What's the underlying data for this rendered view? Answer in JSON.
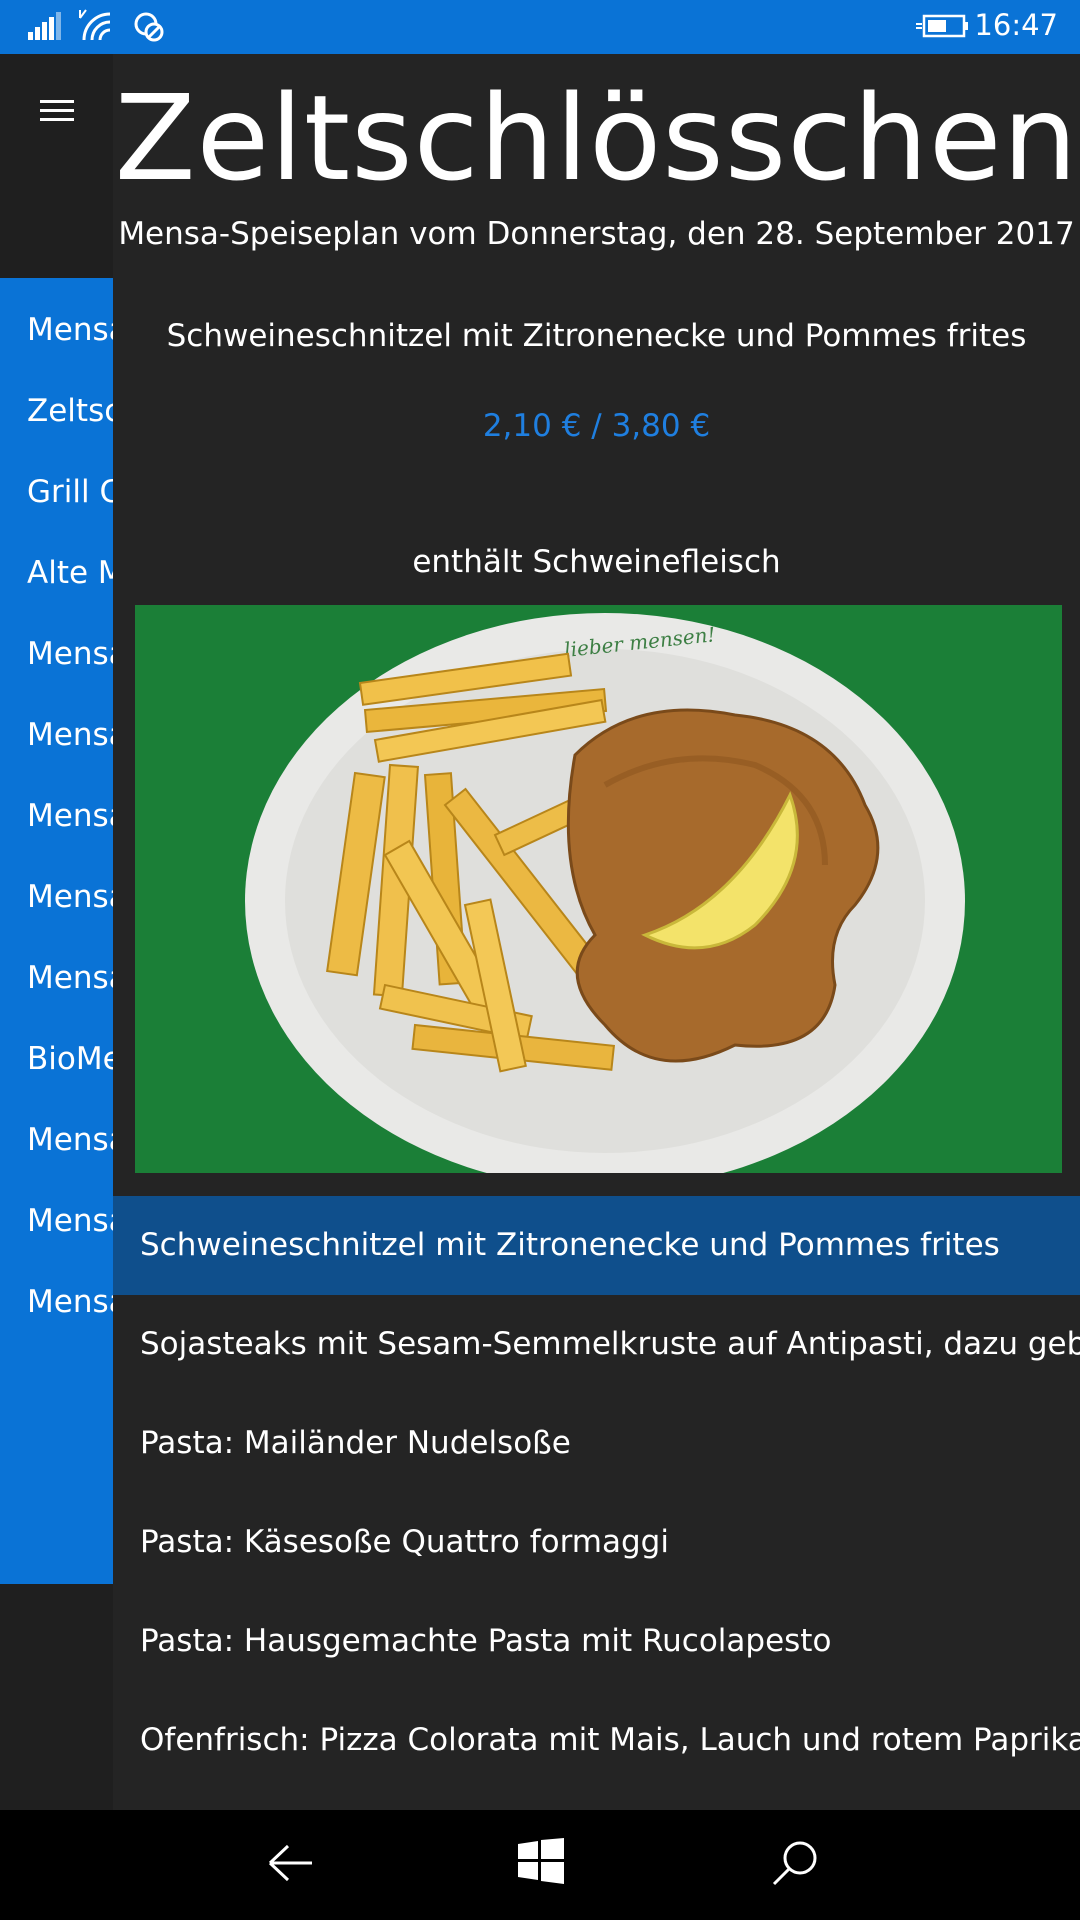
{
  "status_bar": {
    "time": "16:47",
    "icons": [
      "signal-icon",
      "wifi-icon",
      "location-off-icon",
      "battery-charging-icon"
    ],
    "bg_color": "#0a73d6"
  },
  "sidebar": {
    "menu_icon": "hamburger-icon",
    "items": [
      {
        "label": "Mensa"
      },
      {
        "label": "Zeltschlösschen"
      },
      {
        "label": "Grill Cube"
      },
      {
        "label": "Alte Mensa"
      },
      {
        "label": "Mensa"
      },
      {
        "label": "Mensa"
      },
      {
        "label": "Mensa"
      },
      {
        "label": "Mensa"
      },
      {
        "label": "Mensa"
      },
      {
        "label": "BioMensa"
      },
      {
        "label": "Mensa"
      },
      {
        "label": "Mensa"
      },
      {
        "label": "Mensa"
      }
    ]
  },
  "header": {
    "title": "Zeltschlösschen",
    "subtitle": "Mensa-Speiseplan vom Donnerstag, den 28. September 2017"
  },
  "detail": {
    "dish_name": "Schweineschnitzel mit Zitronenecke und Pommes frites",
    "price": "2,10 € / 3,80 €",
    "contains": "enthält Schweinefleisch",
    "image": {
      "plate_text": "lieber mensen!",
      "bg_color": "#1e8a3c"
    },
    "price_color": "#1f7fe0"
  },
  "menu": {
    "selected_index": 0,
    "items": [
      "Schweineschnitzel mit Zitronenecke und Pommes frites",
      "Sojasteaks mit Sesam-Semmelkruste auf Antipasti, dazu gebratene",
      "Pasta: Mailänder Nudelsoße",
      "Pasta: Käsesoße Quattro formaggi",
      "Pasta: Hausgemachte Pasta mit Rucolapesto",
      "Ofenfrisch: Pizza Colorata mit Mais, Lauch und rotem Paprika"
    ]
  },
  "nav_bar": {
    "buttons": [
      "back-icon",
      "windows-icon",
      "search-icon"
    ]
  }
}
